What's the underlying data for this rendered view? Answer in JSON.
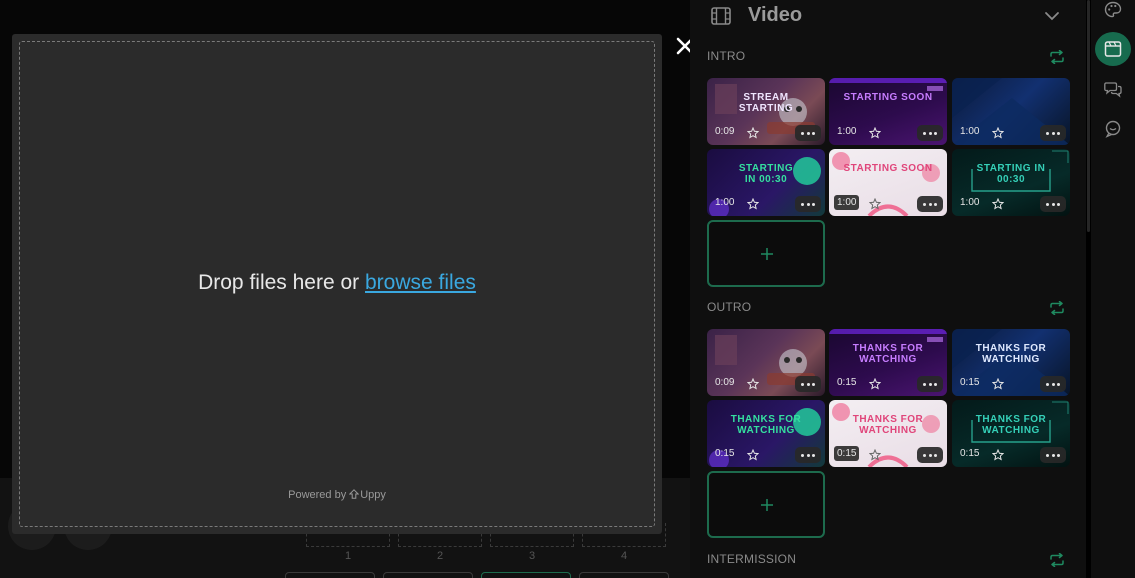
{
  "upload_modal": {
    "drop_text": "Drop files here or ",
    "browse_link": "browse files",
    "powered_by": "Powered by",
    "brand": "Uppy"
  },
  "panel": {
    "title": "Video",
    "sections": [
      {
        "label": "INTRO",
        "items": [
          {
            "duration": "0:09",
            "caption": "STREAM\nSTARTING",
            "style": "cat"
          },
          {
            "duration": "1:00",
            "caption": "STARTING SOON",
            "style": "purple"
          },
          {
            "duration": "1:00",
            "caption": "",
            "style": "blue"
          },
          {
            "duration": "1:00",
            "caption": "STARTING\nIN 00:30",
            "style": "purpleGreen"
          },
          {
            "duration": "1:00",
            "caption": "STARTING SOON",
            "style": "pink"
          },
          {
            "duration": "1:00",
            "caption": "STARTING IN\n00:30",
            "style": "teal"
          }
        ]
      },
      {
        "label": "OUTRO",
        "items": [
          {
            "duration": "0:09",
            "caption": "",
            "style": "cat"
          },
          {
            "duration": "0:15",
            "caption": "THANKS FOR\nWATCHING",
            "style": "purple"
          },
          {
            "duration": "0:15",
            "caption": "THANKS FOR\nWATCHING",
            "style": "blue"
          },
          {
            "duration": "0:15",
            "caption": "THANKS FOR\nWATCHING",
            "style": "purpleGreen"
          },
          {
            "duration": "0:15",
            "caption": "THANKS FOR WATCHING",
            "style": "pink"
          },
          {
            "duration": "0:15",
            "caption": "THANKS FOR\nWATCHING",
            "style": "teal"
          }
        ]
      },
      {
        "label": "INTERMISSION",
        "items": []
      }
    ]
  },
  "bottom_slots": [
    "1",
    "2",
    "3",
    "4"
  ],
  "icons": {
    "close": "close-icon",
    "film": "film-icon",
    "collapse": "chevron-down-icon",
    "loop": "loop-icon",
    "star": "star-icon",
    "more": "more-icon",
    "add": "plus-icon",
    "sidebar": [
      "palette-icon",
      "video-icon",
      "chat-icon",
      "chat-bubble-icon"
    ]
  },
  "colors": {
    "accent": "#1d6b4d",
    "accent_active": "#176b4e",
    "link": "#3aa8e0",
    "modal_bg": "#2b2b2b",
    "panel_bg": "#0f0f0f"
  }
}
